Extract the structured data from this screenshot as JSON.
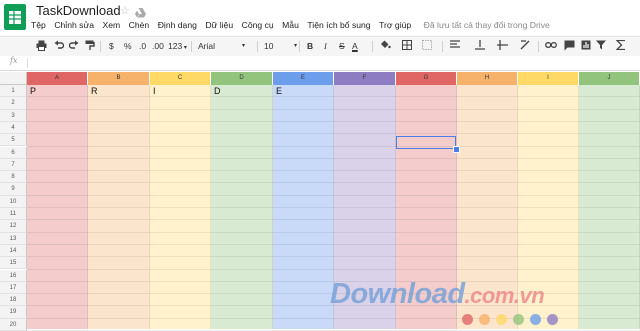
{
  "app": {
    "doc_title": "TaskDownload",
    "menus": [
      "Tệp",
      "Chỉnh sửa",
      "Xem",
      "Chèn",
      "Định dạng",
      "Dữ liệu",
      "Công cụ",
      "Mẫu",
      "Tiện ích bổ sung",
      "Trợ giúp"
    ],
    "save_status": "Đã lưu tất cả thay đổi trong Drive"
  },
  "toolbar": {
    "currency": "$",
    "percent": "%",
    "decimal_decrease": ".0",
    "decimal_increase": ".00",
    "more_formats": "123",
    "font": "Arial",
    "font_size": "10",
    "bold": "B",
    "italic": "I",
    "strike": "S",
    "text_color": "A"
  },
  "formula_bar": {
    "fx": "fx",
    "value": ""
  },
  "columns": [
    {
      "label": "A",
      "header_color": "#e06666",
      "fill": "#f4cccc"
    },
    {
      "label": "B",
      "header_color": "#f6b26b",
      "fill": "#fce5cd"
    },
    {
      "label": "C",
      "header_color": "#ffd966",
      "fill": "#fff2cc"
    },
    {
      "label": "D",
      "header_color": "#93c47d",
      "fill": "#d9ead3"
    },
    {
      "label": "E",
      "header_color": "#6d9eeb",
      "fill": "#c9daf8"
    },
    {
      "label": "F",
      "header_color": "#8e7cc3",
      "fill": "#d9d2e9"
    },
    {
      "label": "G",
      "header_color": "#e06666",
      "fill": "#f4cccc"
    },
    {
      "label": "H",
      "header_color": "#f6b26b",
      "fill": "#fce5cd"
    },
    {
      "label": "I",
      "header_color": "#ffd966",
      "fill": "#fff2cc"
    },
    {
      "label": "J",
      "header_color": "#93c47d",
      "fill": "#d9ead3"
    }
  ],
  "rows": [
    "1",
    "2",
    "3",
    "4",
    "5",
    "6",
    "7",
    "8",
    "9",
    "10",
    "11",
    "12",
    "13",
    "14",
    "15",
    "16",
    "17",
    "18",
    "19",
    "20"
  ],
  "row1_cells": [
    "P",
    "R",
    "I",
    "D",
    "E"
  ],
  "watermark": {
    "main": "Download",
    "suffix": ".com.vn",
    "dot_colors": [
      "#e06666",
      "#f6b26b",
      "#ffd966",
      "#93c47d",
      "#6d9eeb",
      "#8e7cc3"
    ]
  }
}
